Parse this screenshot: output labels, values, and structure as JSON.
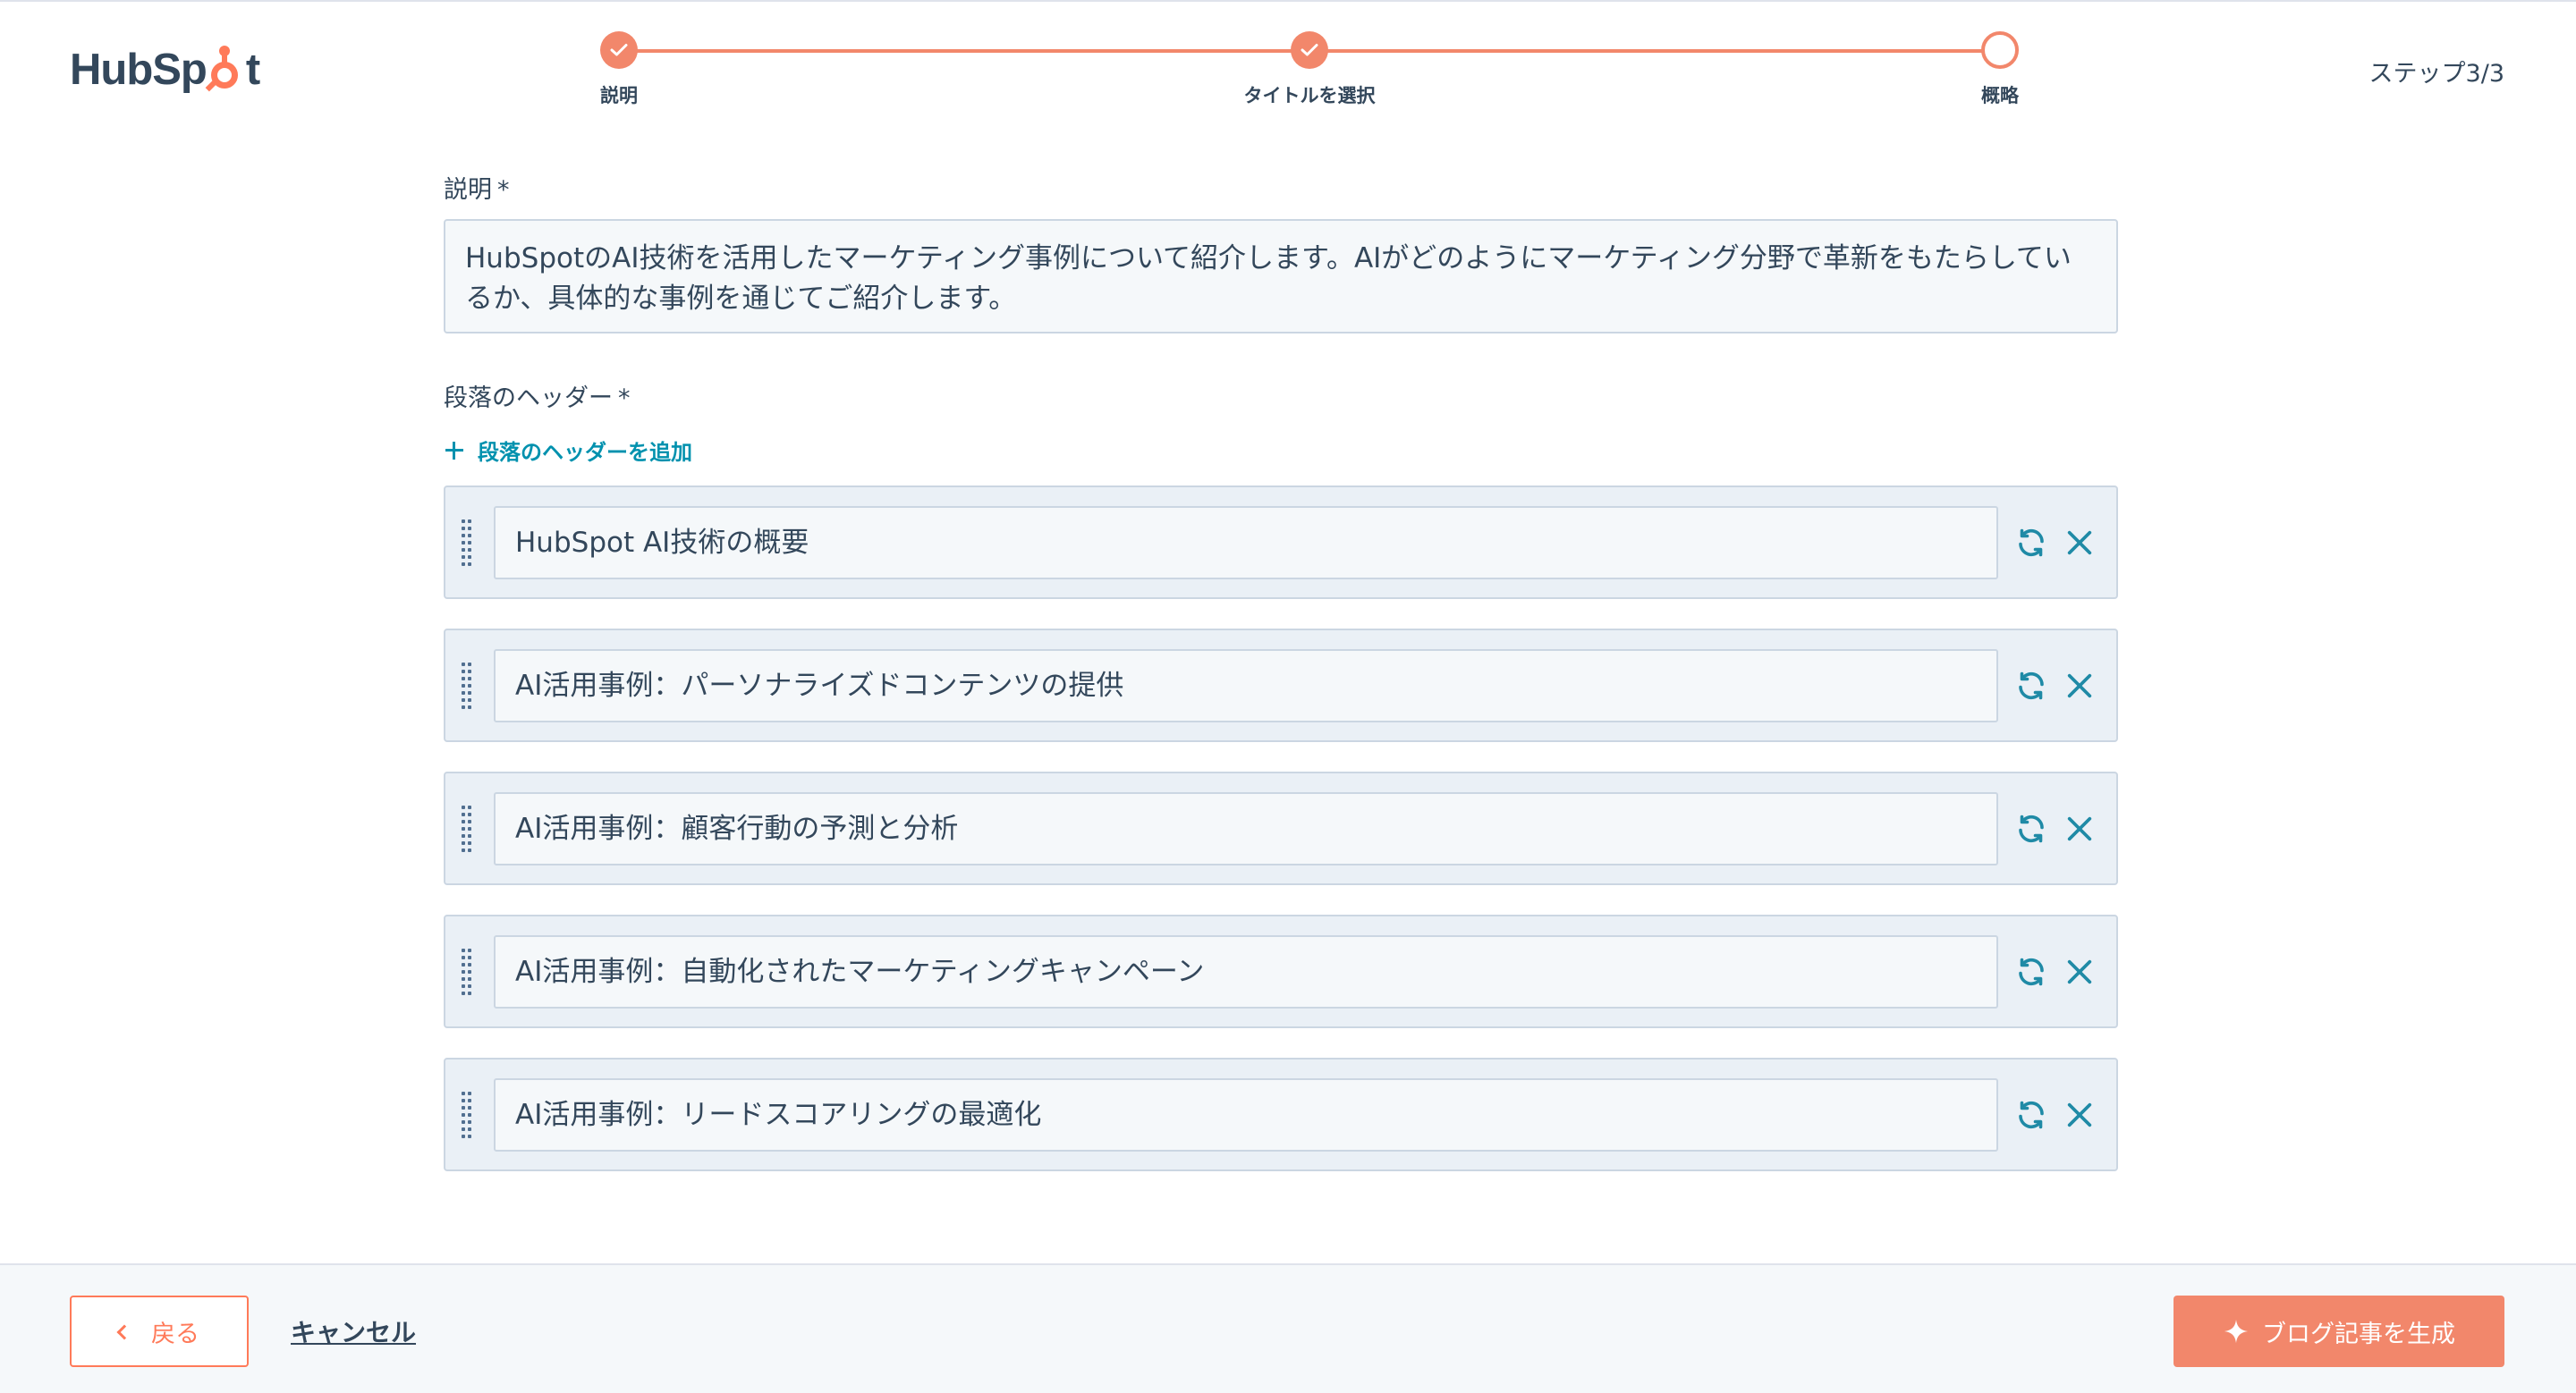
{
  "header": {
    "logo_text_left": "HubSp",
    "logo_text_right": "t",
    "steps": [
      {
        "label": "説明",
        "state": "done"
      },
      {
        "label": "タイトルを選択",
        "state": "done"
      },
      {
        "label": "概略",
        "state": "current"
      }
    ],
    "step_count": "ステップ3/3"
  },
  "description": {
    "label": "説明",
    "required_mark": "*",
    "value": "HubSpotのAI技術を活用したマーケティング事例について紹介します。AIがどのようにマーケティング分野で革新をもたらしているか、具体的な事例を通じてご紹介します。"
  },
  "headers": {
    "label": "段落のヘッダー",
    "required_mark": "*",
    "add_label": "段落のヘッダーを追加",
    "items": [
      {
        "value": "HubSpot AI技術の概要"
      },
      {
        "value": "AI活用事例：パーソナライズドコンテンツの提供"
      },
      {
        "value": "AI活用事例：顧客行動の予測と分析"
      },
      {
        "value": "AI活用事例：自動化されたマーケティングキャンペーン"
      },
      {
        "value": "AI活用事例：リードスコアリングの最適化"
      }
    ]
  },
  "footer": {
    "back_label": "戻る",
    "cancel_label": "キャンセル",
    "generate_label": "ブログ記事を生成"
  },
  "colors": {
    "accent": "#f2876b",
    "brand_orange": "#ff7a59",
    "link": "#0091ae",
    "icon_teal": "#1f8aa6",
    "text": "#33475b"
  },
  "icons": {
    "step_done": "checkmark-icon",
    "drag": "drag-handle-icon",
    "regenerate": "refresh-icon",
    "delete": "close-icon",
    "add": "plus-icon",
    "back": "chevron-left-icon",
    "generate": "sparkle-icon"
  }
}
